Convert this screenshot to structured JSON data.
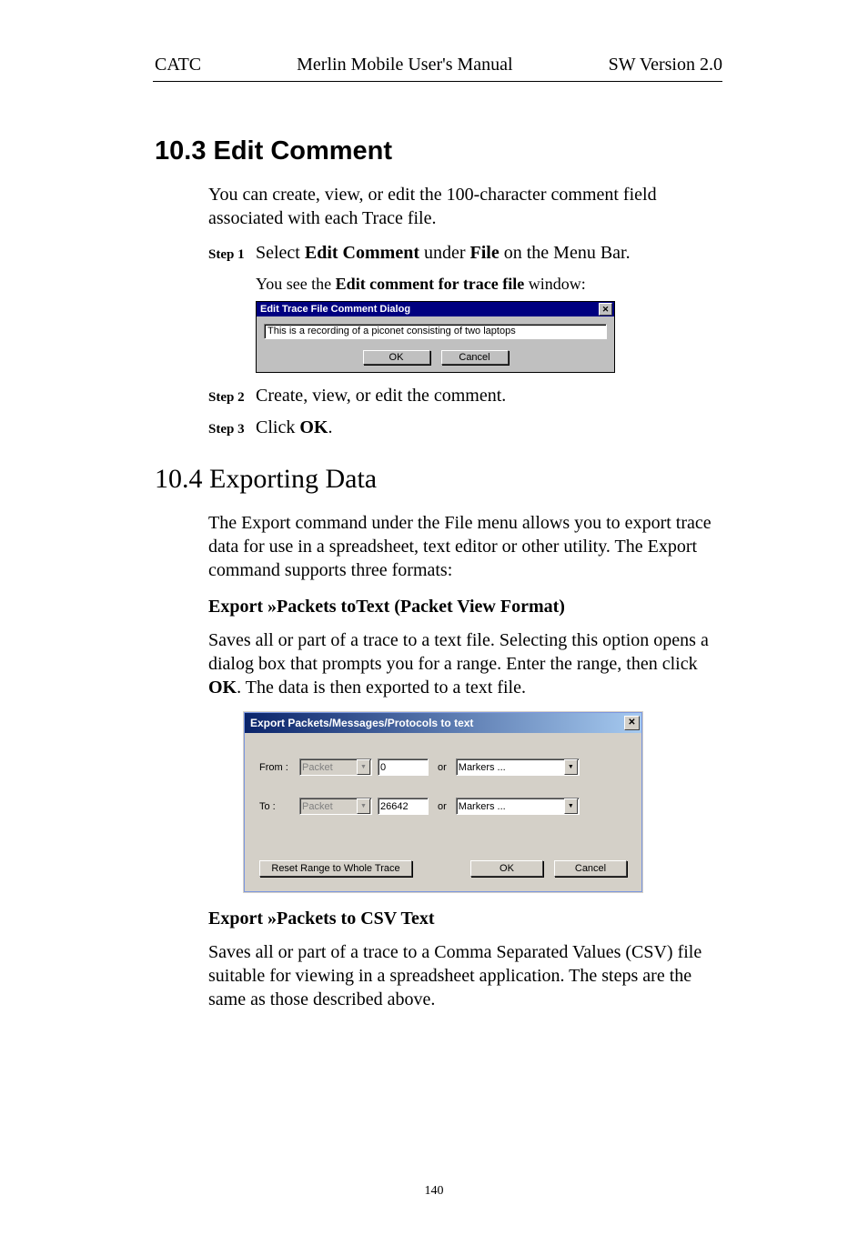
{
  "header": {
    "left": "CATC",
    "center": "Merlin Mobile User's Manual",
    "right": "SW Version 2.0"
  },
  "s103": {
    "heading": "10.3  Edit Comment",
    "intro": "You can create, view, or edit the 100-character comment field associated with each Trace file.",
    "step1": {
      "label": "Step 1",
      "before": "Select ",
      "b1": "Edit Comment",
      "mid": " under ",
      "b2": "File",
      "after": " on the Menu Bar."
    },
    "yousee": {
      "pre": "You see the ",
      "bold": "Edit comment for trace file",
      "post": " window:"
    },
    "dlg": {
      "title": "Edit Trace File Comment Dialog",
      "input": "This is a recording of a piconet consisting of two laptops",
      "ok": "OK",
      "cancel": "Cancel"
    },
    "step2": {
      "label": "Step 2",
      "text": "Create, view, or edit the comment."
    },
    "step3": {
      "label": "Step 3",
      "before": "Click ",
      "bold": "OK",
      "after": "."
    }
  },
  "s104": {
    "heading": "10.4  Exporting Data",
    "intro": "The Export command under the File menu allows you to export trace data for use in a spreadsheet, text editor or other utility.  The Export command supports three formats:",
    "sub1": "Export »Packets toText (Packet View Format)",
    "p1a": "Saves all or part of a trace to a text file.  Selecting this option opens a dialog box that prompts you for a range.  Enter the range, then click ",
    "p1b": "OK",
    "p1c": ".  The data is then exported to a text file.",
    "dlg": {
      "title": "Export Packets/Messages/Protocols to text",
      "from": "From :",
      "to": "To :",
      "packet": "Packet",
      "fromVal": "0",
      "toVal": "26642",
      "or": "or",
      "markers": "Markers ...",
      "reset": "Reset Range to Whole Trace",
      "ok": "OK",
      "cancel": "Cancel"
    },
    "sub2": "Export »Packets to CSV Text",
    "p2": "Saves all or part of a trace to a Comma Separated Values (CSV) file suitable for viewing in a spreadsheet application.  The steps are the same as those described above."
  },
  "pageNum": "140"
}
